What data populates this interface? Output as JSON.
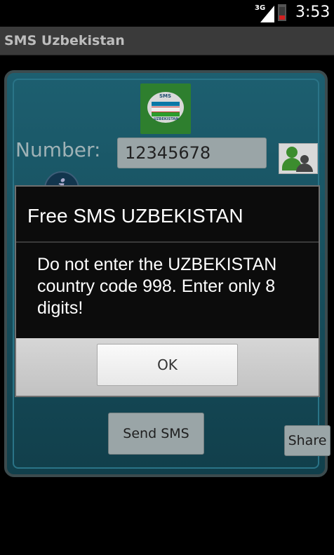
{
  "status_bar": {
    "network": "3G",
    "time": "3:53"
  },
  "app": {
    "title": "SMS Uzbekistan"
  },
  "main": {
    "logo_text": "SMS",
    "logo_subtext": "UZBEKISTAN",
    "number_label": "Number:",
    "number_value": "12345678",
    "info_glyph": "i",
    "send_label": "Send SMS",
    "share_label": "Share"
  },
  "dialog": {
    "title": "Free SMS UZBEKISTAN",
    "message": "Do not enter the UZBEKISTAN country code 998.  Enter only 8 digits!",
    "ok_label": "OK"
  },
  "icons": [
    "signal-icon",
    "battery-icon",
    "contacts-icon",
    "info-icon"
  ],
  "colors": {
    "panel": "#1d5f70",
    "title_bar": "#3a3a3a",
    "battery_low": "#d21f1f"
  }
}
